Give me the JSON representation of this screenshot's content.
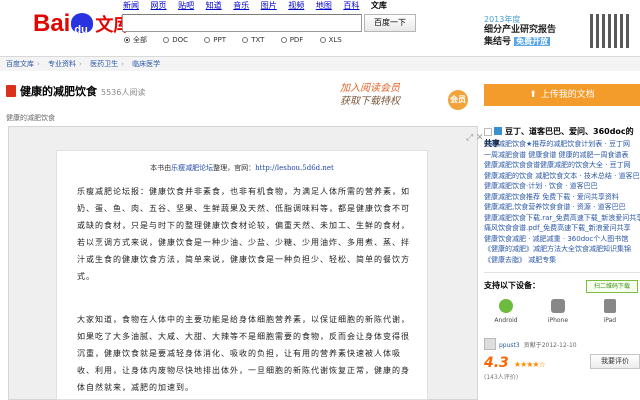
{
  "header": {
    "logo": {
      "bai": "Bai",
      "du": "du",
      "wenku": "文库"
    },
    "nav": [
      "新闻",
      "网页",
      "贴吧",
      "知道",
      "音乐",
      "图片",
      "视频",
      "地图",
      "百科",
      "文库"
    ],
    "nav_current": "文库",
    "search": {
      "value": "",
      "button": "百度一下"
    },
    "filters": [
      "全部",
      "DOC",
      "PPT",
      "TXT",
      "PDF",
      "XLS"
    ],
    "filter_selected": "全部",
    "ad": {
      "year": "2013年度",
      "line1": "细分产业研究报告",
      "line2": "集结号",
      "tag": "免费开放"
    }
  },
  "breadcrumb": [
    "百度文库",
    "专业资料",
    "医药卫生",
    "临床医学"
  ],
  "document": {
    "title": "健康的减肥饮食",
    "views": "5536人阅读",
    "subtitle": "健康的减肥饮食",
    "slogan1": "加入阅读会员",
    "slogan2": "获取下载特权",
    "vip": "会员",
    "source_prefix": "本书由",
    "source_link": "乐瘦减肥论坛",
    "source_mid": "整理，官网：",
    "source_url": "http://leshou.5d6d.net",
    "para1": "乐瘦减肥论坛报：健康饮食并非素食，也非有机食物，为满足人体所需的营养素，如奶、蛋、鱼、肉、五谷、坚果、生鲜蔬果及天然、低脂调味料等，都是健康饮食不可或缺的食材，只是与时下的整理健康饮食材论较，偏重天然、未加工、生鲜的食材，若以烹调方式来说，健康饮食是一种少油、少盐、少糖、少用油炸、多用煮、蒸、拌汁或生食的健康饮食方法，简单来说，健康饮食是一种负担少、轻松、简单的餐饮方式。",
    "para2": "大家知道，食物在人体中的主要功能是给身体细胞营养素，以保证细胞的新陈代谢，如果吃了大多油腻、大咸、大甜、大辣等不是细胞需要的食物，反而会让身体变得很沉重，健康饮食就是要减轻身体消化、吸收的负担，让有用的营养素快速被人体吸收、利用，让身体内废物尽快地排出体外，一旦细胞的新陈代谢恢复正常，健康的身体自然就来，减肥的加速到。"
  },
  "sidebar": {
    "upload_button": "上传我的文档",
    "related_title": "豆丁、道客巴巴、爱问、360doc的共享",
    "related": [
      "健康减肥饮食★推荐的减肥饮食计划表 · 豆丁网",
      "一周减肥食谱 健康食谱 健康的减肥一周食谱表",
      "健康减肥饮食食谱健康减肥的饮食大全 · 豆丁网",
      "健康减肥的饮食 减肥饮食文本 · 技术总结 · 道客巴巴",
      "健康减肥饮食·计划 · 饮食 · 道客巴巴",
      "健康减肥饮食推荐 免费下载 · 爱问共享资料",
      "健康减肥,饮食营养饮食食谱 · 资源 · 道客巴巴",
      "健康减肥饮食下载.rar_免费高速下载_新浪爱问共享",
      "痛风饮食食谱.pdf_免费高速下载_新浪爱问共享",
      "健康饮食减肥 · 减肥减重 · 360doc个人图书馆",
      "《健康的减肥》减肥方法大全饮食减肥知识集锦",
      "《健康去脂》 减肥专集"
    ],
    "device_label": "支持以下设备：",
    "device_button": "扫二维码下载",
    "devices": [
      "Android",
      "iPhone",
      "iPad"
    ],
    "uploader": {
      "name": "ppust3",
      "date": "贡献于2012-12-10"
    },
    "rating": {
      "score": "4.3",
      "stars": "★★★★☆",
      "count": "(143人评价)",
      "button": "我要评价"
    }
  }
}
